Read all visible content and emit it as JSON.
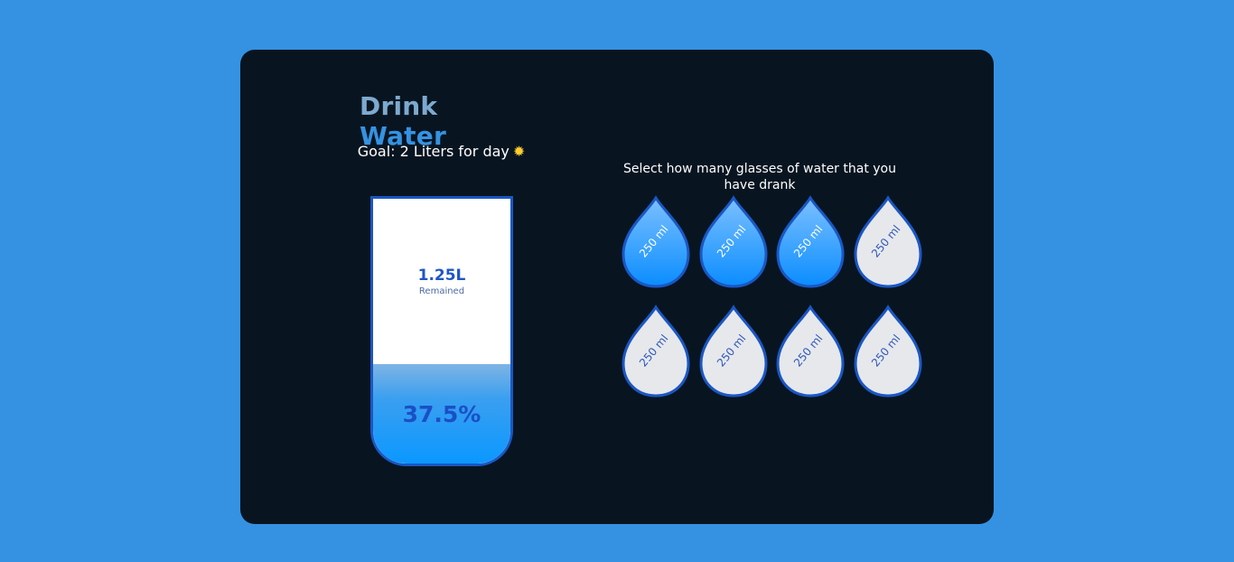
{
  "header": {
    "title_part1": "Drink",
    "title_part2": "Water",
    "goal_text": "Goal: 2 Liters for day",
    "goal_icon": "sun-icon"
  },
  "cup": {
    "remained_value": "1.25L",
    "remained_label": "Remained",
    "percentage_text": "37.5%",
    "fill_fraction": 0.375
  },
  "selector": {
    "instruction": "Select how many glasses of water that you have drank",
    "glasses": [
      {
        "label": "250 ml",
        "filled": true
      },
      {
        "label": "250 ml",
        "filled": true
      },
      {
        "label": "250 ml",
        "filled": true
      },
      {
        "label": "250 ml",
        "filled": false
      },
      {
        "label": "250 ml",
        "filled": false
      },
      {
        "label": "250 ml",
        "filled": false
      },
      {
        "label": "250 ml",
        "filled": false
      },
      {
        "label": "250 ml",
        "filled": false
      }
    ]
  },
  "colors": {
    "page_bg": "#3592e2",
    "card_bg": "#081521",
    "accent": "#3592e2",
    "drop_full_top": "#7cc0ff",
    "drop_full_bottom": "#0a8dff",
    "drop_empty": "#e6e8ec",
    "drop_border": "#1b57c4"
  }
}
